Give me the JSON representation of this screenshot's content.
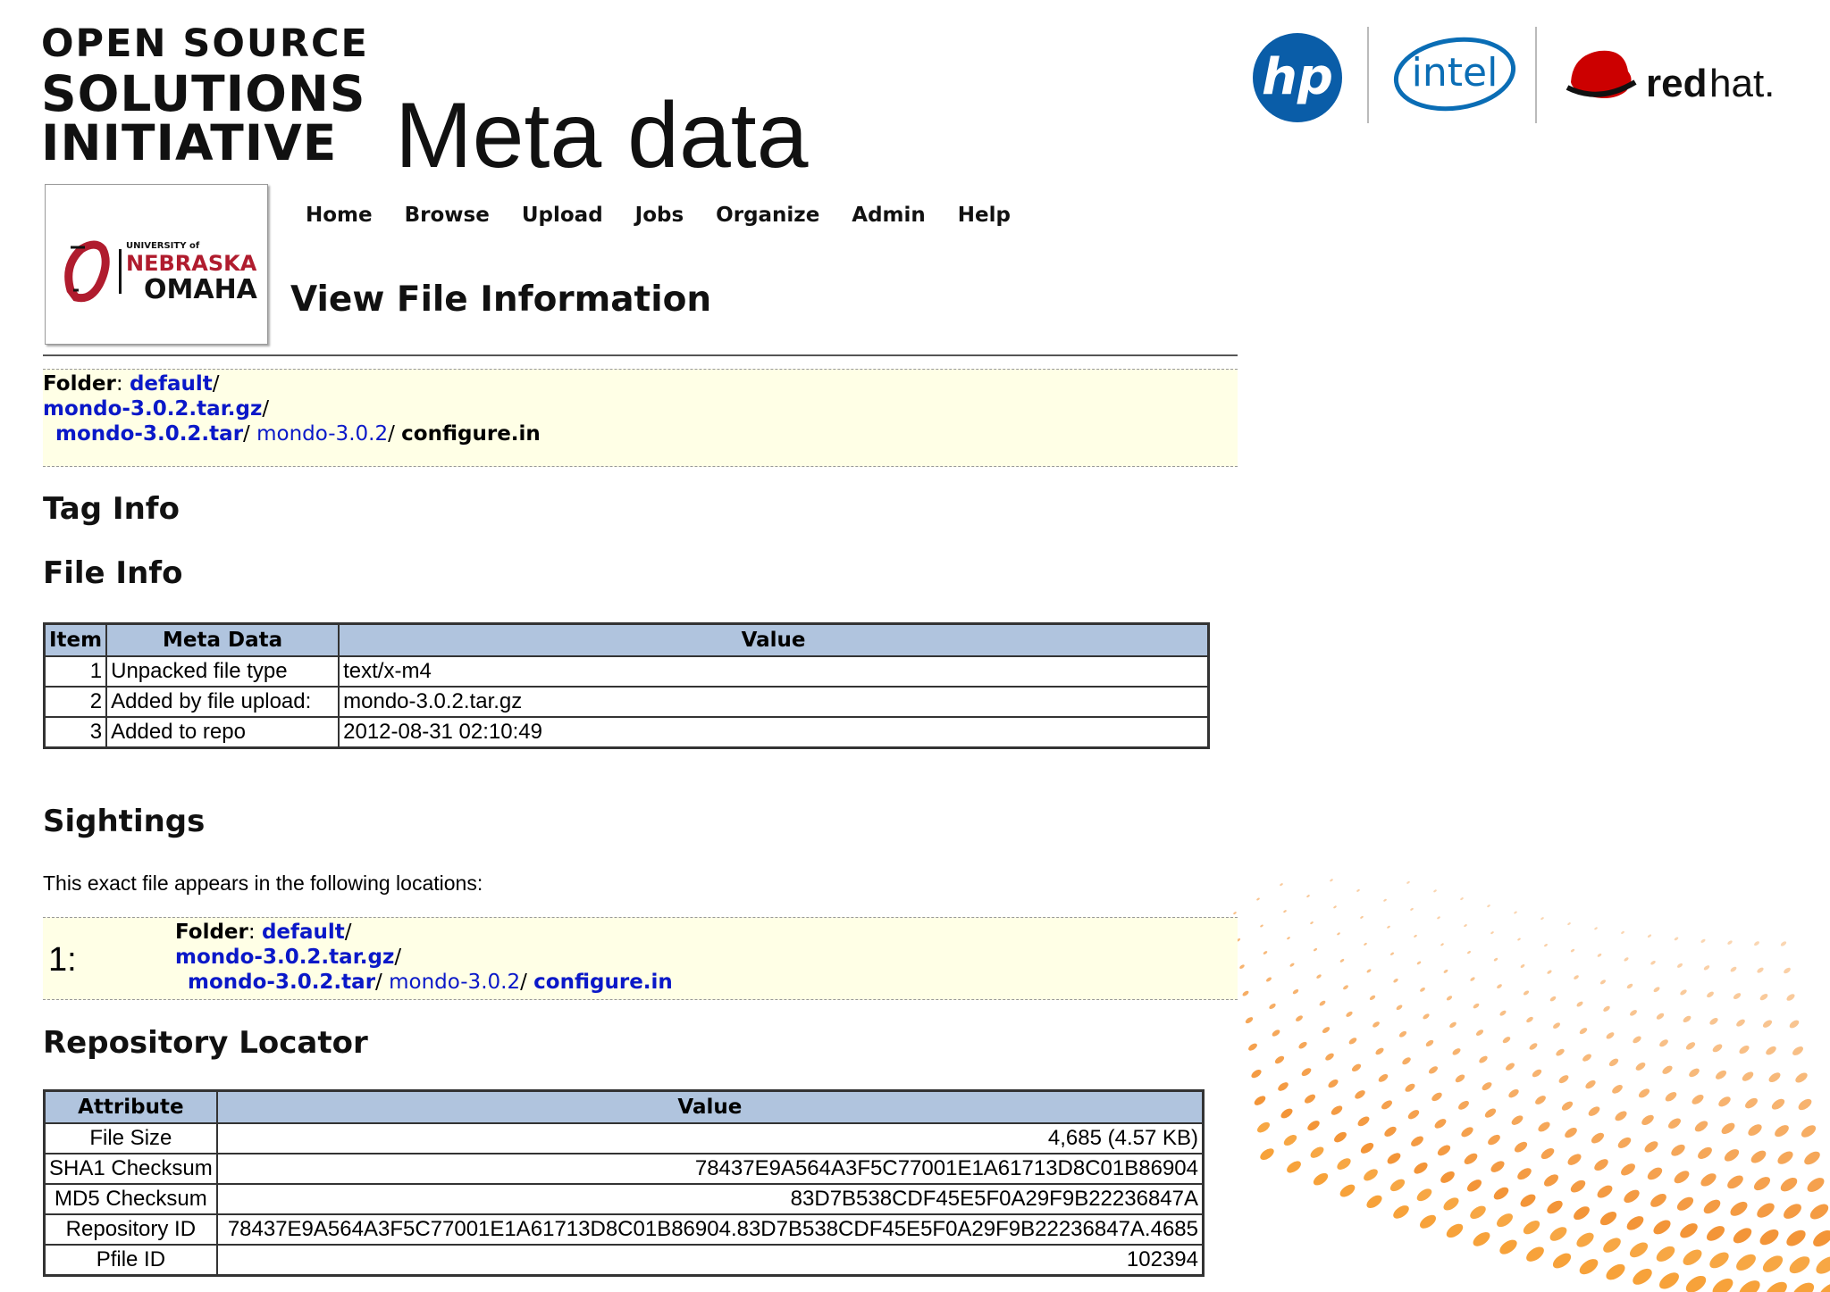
{
  "slide": {
    "brand_line1": "OPEN SOURCE",
    "brand_line2": "SOLUTIONS",
    "brand_line3": "INITIATIVE",
    "title": "Meta data",
    "partner_logos": [
      "hp",
      "intel",
      "redhat"
    ],
    "colors": {
      "hp_blue": "#0a5da8",
      "intel_blue": "#0a6db5",
      "redhat_red": "#cc0000",
      "accent_orange": "#f28a22"
    }
  },
  "university_logo": {
    "line1": "UNIVERSITY of",
    "line2": "NEBRASKA",
    "line3": "OMAHA"
  },
  "nav": [
    "Home",
    "Browse",
    "Upload",
    "Jobs",
    "Organize",
    "Admin",
    "Help"
  ],
  "page_heading": "View File Information",
  "breadcrumb": {
    "folder_label": "Folder",
    "folder": "default",
    "archive": "mondo-3.0.2.tar.gz",
    "tar": "mondo-3.0.2.tar",
    "dir": "mondo-3.0.2",
    "file": "configure.in"
  },
  "tag_info_heading": "Tag Info",
  "file_info_heading": "File Info",
  "file_info_table": {
    "headers": [
      "Item",
      "Meta Data",
      "Value"
    ],
    "rows": [
      {
        "item": "1",
        "meta": "Unpacked file type",
        "value": "text/x-m4"
      },
      {
        "item": "2",
        "meta": "Added by file upload:",
        "value": "mondo-3.0.2.tar.gz"
      },
      {
        "item": "3",
        "meta": "Added to repo",
        "value": "2012-08-31 02:10:49"
      }
    ]
  },
  "sightings": {
    "heading": "Sightings",
    "description": "This exact file appears in the following locations:",
    "items": [
      {
        "index": "1:",
        "folder_label": "Folder",
        "folder": "default",
        "archive": "mondo-3.0.2.tar.gz",
        "tar": "mondo-3.0.2.tar",
        "dir": "mondo-3.0.2",
        "file": "configure.in"
      }
    ]
  },
  "repository_locator": {
    "heading": "Repository Locator",
    "headers": [
      "Attribute",
      "Value"
    ],
    "rows": [
      {
        "attribute": "File Size",
        "value": "4,685 (4.57 KB)"
      },
      {
        "attribute": "SHA1 Checksum",
        "value": "78437E9A564A3F5C77001E1A61713D8C01B86904"
      },
      {
        "attribute": "MD5 Checksum",
        "value": "83D7B538CDF45E5F0A29F9B22236847A"
      },
      {
        "attribute": "Repository ID",
        "value": "78437E9A564A3F5C77001E1A61713D8C01B86904.83D7B538CDF45E5F0A29F9B22236847A.4685"
      },
      {
        "attribute": "Pfile ID",
        "value": "102394"
      }
    ]
  }
}
